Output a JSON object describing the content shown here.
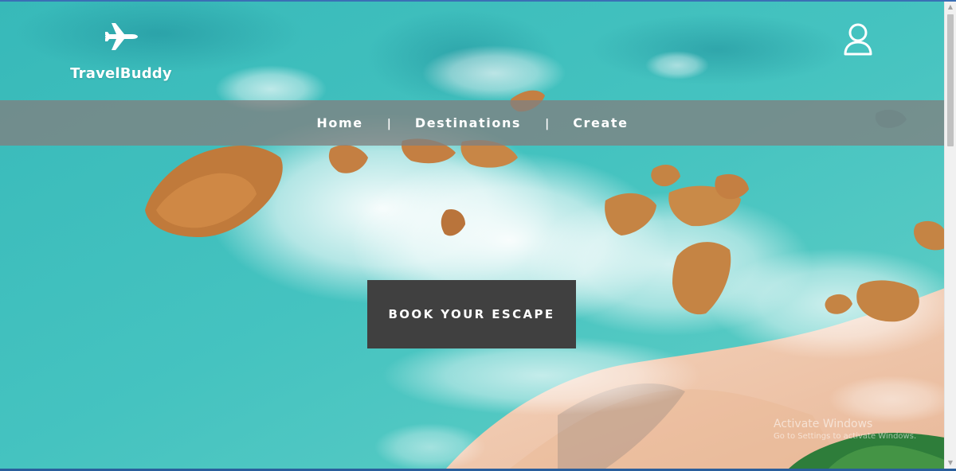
{
  "brand": {
    "name": "TravelBuddy",
    "icon": "airplane-icon",
    "color": "#ffffff"
  },
  "header": {
    "account_icon": "user-icon"
  },
  "nav": {
    "items": [
      {
        "label": "Home"
      },
      {
        "label": "Destinations"
      },
      {
        "label": "Create"
      }
    ],
    "separator": "|",
    "band_color": "#808080"
  },
  "hero": {
    "cta_label": "BOOK YOUR ESCAPE",
    "cta_color": "#404040",
    "sea_color": "#2fb7b5",
    "sand_color": "#f0c6a8"
  },
  "watermark": {
    "title": "Activate Windows",
    "subtitle": "Go to Settings to activate Windows."
  }
}
